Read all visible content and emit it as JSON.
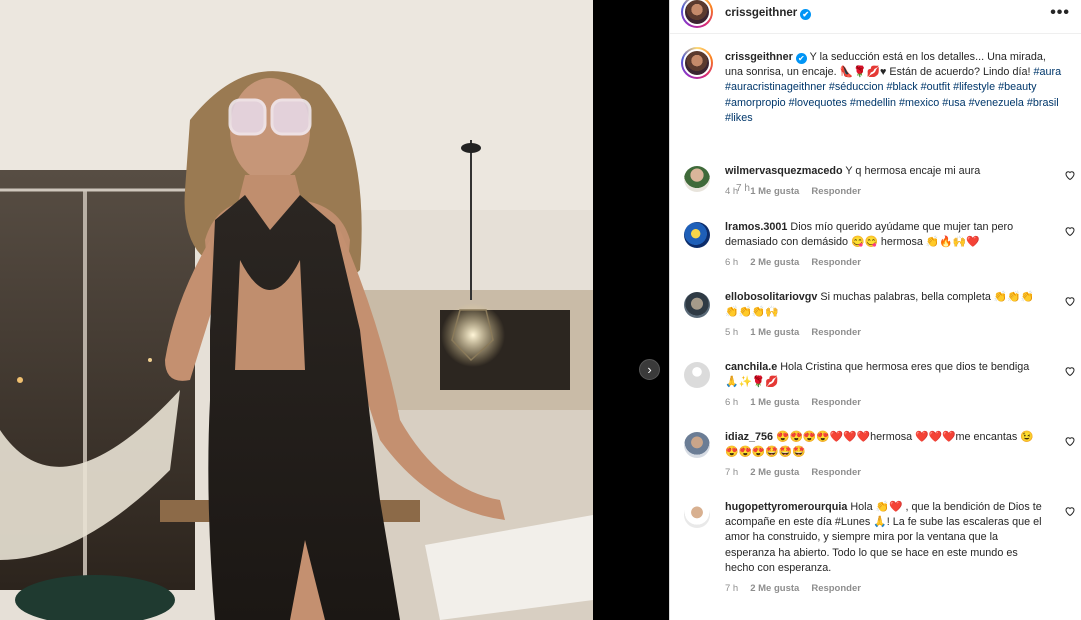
{
  "header": {
    "username": "crissgeithner",
    "verified_mark": "✔",
    "more_glyph": "•••"
  },
  "media": {
    "next_glyph": "›"
  },
  "caption": {
    "username": "crissgeithner",
    "text": " Y la seducción está en los detalles... Una mirada, una sonrisa, un encaje. 👠🌹💋♥ Están de acuerdo? Lindo día! ",
    "hashtags": "#aura #auracristinageithner #séduccion #black #outfit #lifestyle #beauty #amorpropio #lovequotes #medellin #mexico #usa #venezuela #brasil #likes",
    "time": "7 h"
  },
  "comments": [
    {
      "username": "wilmervasquezmacedo",
      "text": " Y q hermosa encaje mi aura",
      "time": "4 h",
      "likes": "1 Me gusta",
      "reply": "Responder"
    },
    {
      "username": "lramos.3001",
      "text": " Dios mío querido ayúdame que mujer tan pero demasiado con demásido 😋😋 hermosa 👏🔥🙌❤️",
      "time": "6 h",
      "likes": "2 Me gusta",
      "reply": "Responder"
    },
    {
      "username": "ellobosolitariovgv",
      "text": " Si muchas palabras, bella completa 👏👏👏👏👏👏🙌",
      "time": "5 h",
      "likes": "1 Me gusta",
      "reply": "Responder"
    },
    {
      "username": "canchila.e",
      "text": " Hola Cristina que hermosa eres que dios te bendiga 🙏✨🌹💋",
      "time": "6 h",
      "likes": "1 Me gusta",
      "reply": "Responder"
    },
    {
      "username": "idiaz_756",
      "text": " 😍😍😍😍❤️❤️❤️hermosa ❤️❤️❤️me encantas 😉😍😍😍🤩🤩🤩",
      "time": "7 h",
      "likes": "2 Me gusta",
      "reply": "Responder"
    },
    {
      "username": "hugopettyromerourquia",
      "text": " Hola 👏❤️ , que la bendición de Dios te acompañe en este día #Lunes 🙏! La fe sube las escaleras que el amor ha construido, y siempre mira por la ventana que la esperanza ha abierto. Todo lo que se hace en este mundo es hecho con esperanza.",
      "time": "7 h",
      "likes": "2 Me gusta",
      "reply": "Responder"
    }
  ],
  "colors": {
    "link": "#00376b",
    "meta": "#8e8e8e",
    "verified": "#0095f6"
  }
}
